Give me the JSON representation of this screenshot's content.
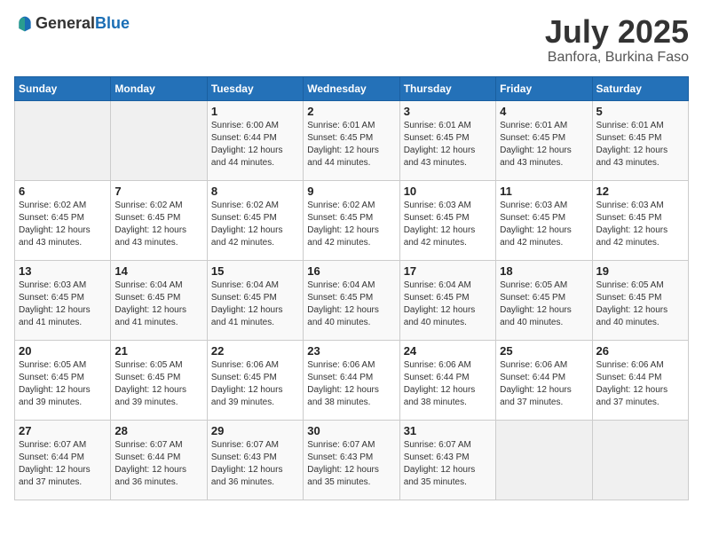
{
  "header": {
    "logo_general": "General",
    "logo_blue": "Blue",
    "title": "July 2025",
    "location": "Banfora, Burkina Faso"
  },
  "calendar": {
    "days_of_week": [
      "Sunday",
      "Monday",
      "Tuesday",
      "Wednesday",
      "Thursday",
      "Friday",
      "Saturday"
    ],
    "weeks": [
      [
        {
          "day": "",
          "empty": true
        },
        {
          "day": "",
          "empty": true
        },
        {
          "day": "1",
          "sunrise": "6:00 AM",
          "sunset": "6:44 PM",
          "daylight": "12 hours and 44 minutes."
        },
        {
          "day": "2",
          "sunrise": "6:01 AM",
          "sunset": "6:45 PM",
          "daylight": "12 hours and 44 minutes."
        },
        {
          "day": "3",
          "sunrise": "6:01 AM",
          "sunset": "6:45 PM",
          "daylight": "12 hours and 43 minutes."
        },
        {
          "day": "4",
          "sunrise": "6:01 AM",
          "sunset": "6:45 PM",
          "daylight": "12 hours and 43 minutes."
        },
        {
          "day": "5",
          "sunrise": "6:01 AM",
          "sunset": "6:45 PM",
          "daylight": "12 hours and 43 minutes."
        }
      ],
      [
        {
          "day": "6",
          "sunrise": "6:02 AM",
          "sunset": "6:45 PM",
          "daylight": "12 hours and 43 minutes."
        },
        {
          "day": "7",
          "sunrise": "6:02 AM",
          "sunset": "6:45 PM",
          "daylight": "12 hours and 43 minutes."
        },
        {
          "day": "8",
          "sunrise": "6:02 AM",
          "sunset": "6:45 PM",
          "daylight": "12 hours and 42 minutes."
        },
        {
          "day": "9",
          "sunrise": "6:02 AM",
          "sunset": "6:45 PM",
          "daylight": "12 hours and 42 minutes."
        },
        {
          "day": "10",
          "sunrise": "6:03 AM",
          "sunset": "6:45 PM",
          "daylight": "12 hours and 42 minutes."
        },
        {
          "day": "11",
          "sunrise": "6:03 AM",
          "sunset": "6:45 PM",
          "daylight": "12 hours and 42 minutes."
        },
        {
          "day": "12",
          "sunrise": "6:03 AM",
          "sunset": "6:45 PM",
          "daylight": "12 hours and 42 minutes."
        }
      ],
      [
        {
          "day": "13",
          "sunrise": "6:03 AM",
          "sunset": "6:45 PM",
          "daylight": "12 hours and 41 minutes."
        },
        {
          "day": "14",
          "sunrise": "6:04 AM",
          "sunset": "6:45 PM",
          "daylight": "12 hours and 41 minutes."
        },
        {
          "day": "15",
          "sunrise": "6:04 AM",
          "sunset": "6:45 PM",
          "daylight": "12 hours and 41 minutes."
        },
        {
          "day": "16",
          "sunrise": "6:04 AM",
          "sunset": "6:45 PM",
          "daylight": "12 hours and 40 minutes."
        },
        {
          "day": "17",
          "sunrise": "6:04 AM",
          "sunset": "6:45 PM",
          "daylight": "12 hours and 40 minutes."
        },
        {
          "day": "18",
          "sunrise": "6:05 AM",
          "sunset": "6:45 PM",
          "daylight": "12 hours and 40 minutes."
        },
        {
          "day": "19",
          "sunrise": "6:05 AM",
          "sunset": "6:45 PM",
          "daylight": "12 hours and 40 minutes."
        }
      ],
      [
        {
          "day": "20",
          "sunrise": "6:05 AM",
          "sunset": "6:45 PM",
          "daylight": "12 hours and 39 minutes."
        },
        {
          "day": "21",
          "sunrise": "6:05 AM",
          "sunset": "6:45 PM",
          "daylight": "12 hours and 39 minutes."
        },
        {
          "day": "22",
          "sunrise": "6:06 AM",
          "sunset": "6:45 PM",
          "daylight": "12 hours and 39 minutes."
        },
        {
          "day": "23",
          "sunrise": "6:06 AM",
          "sunset": "6:44 PM",
          "daylight": "12 hours and 38 minutes."
        },
        {
          "day": "24",
          "sunrise": "6:06 AM",
          "sunset": "6:44 PM",
          "daylight": "12 hours and 38 minutes."
        },
        {
          "day": "25",
          "sunrise": "6:06 AM",
          "sunset": "6:44 PM",
          "daylight": "12 hours and 37 minutes."
        },
        {
          "day": "26",
          "sunrise": "6:06 AM",
          "sunset": "6:44 PM",
          "daylight": "12 hours and 37 minutes."
        }
      ],
      [
        {
          "day": "27",
          "sunrise": "6:07 AM",
          "sunset": "6:44 PM",
          "daylight": "12 hours and 37 minutes."
        },
        {
          "day": "28",
          "sunrise": "6:07 AM",
          "sunset": "6:44 PM",
          "daylight": "12 hours and 36 minutes."
        },
        {
          "day": "29",
          "sunrise": "6:07 AM",
          "sunset": "6:43 PM",
          "daylight": "12 hours and 36 minutes."
        },
        {
          "day": "30",
          "sunrise": "6:07 AM",
          "sunset": "6:43 PM",
          "daylight": "12 hours and 35 minutes."
        },
        {
          "day": "31",
          "sunrise": "6:07 AM",
          "sunset": "6:43 PM",
          "daylight": "12 hours and 35 minutes."
        },
        {
          "day": "",
          "empty": true
        },
        {
          "day": "",
          "empty": true
        }
      ]
    ]
  }
}
